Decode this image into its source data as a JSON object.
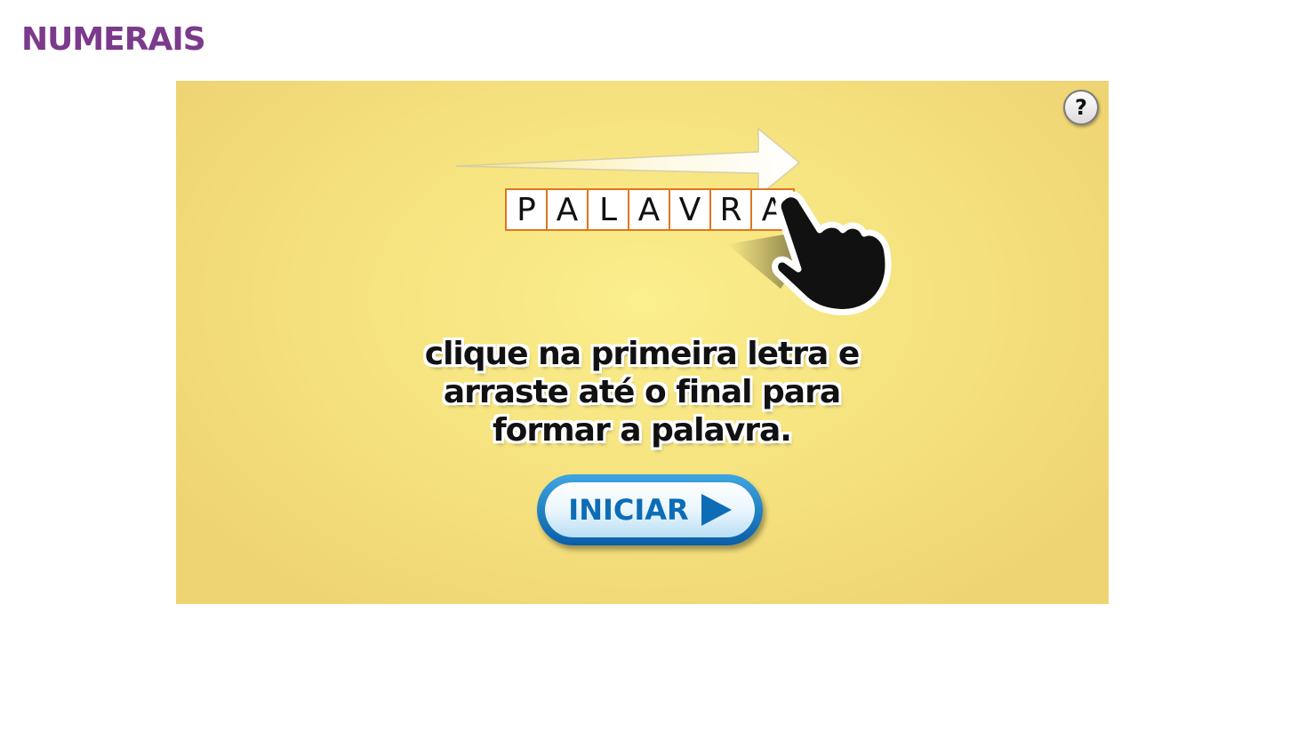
{
  "page": {
    "title": "NUMERAIS"
  },
  "game": {
    "help_label": "?",
    "example_word_letters": [
      "P",
      "A",
      "L",
      "A",
      "V",
      "R",
      "A"
    ],
    "instruction_lines": [
      "clique na primeira letra e",
      "arraste até o final para",
      "formar a palavra."
    ],
    "start_button_label": "INICIAR",
    "icons": {
      "help": "question-mark-icon",
      "drag_direction": "arrow-right-icon",
      "pointer": "pointing-hand-icon",
      "start": "play-triangle-icon"
    },
    "colors": {
      "title": "#7b3a8c",
      "background": "#f5e27e",
      "letter_border": "#e0761e",
      "button_blue": "#0d6cb6"
    }
  }
}
